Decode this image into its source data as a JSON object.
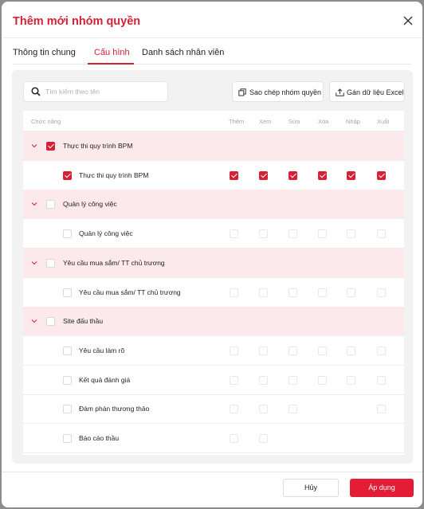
{
  "dialog": {
    "title": "Thêm mới nhóm quyền",
    "close_icon": "close-icon"
  },
  "tabs": [
    {
      "label": "Thông tin chung",
      "active": false
    },
    {
      "label": "Cấu hình",
      "active": true
    },
    {
      "label": "Danh sách nhân viên",
      "active": false
    }
  ],
  "toolbar": {
    "search_placeholder": "Tìm kiếm theo tên",
    "copy_label": "Sao chép nhóm quyền",
    "excel_label": "Gán dữ liệu Excel"
  },
  "table": {
    "headers": [
      "Chức năng",
      "Thêm",
      "Xem",
      "Sửa",
      "Xóa",
      "Nhập",
      "Xuất"
    ],
    "rows": [
      {
        "type": "group",
        "label": "Thực thi quy trình BPM",
        "checked": true
      },
      {
        "type": "item",
        "label": "Thực thi quy trình BPM",
        "checked": true,
        "perms": [
          true,
          true,
          true,
          true,
          true,
          true
        ]
      },
      {
        "type": "group",
        "label": "Quản lý công việc",
        "checked": false
      },
      {
        "type": "item",
        "label": "Quản lý công việc",
        "checked": false,
        "perms": [
          false,
          false,
          false,
          false,
          false,
          false
        ]
      },
      {
        "type": "group",
        "label": "Yêu cầu mua sắm/ TT chủ trương",
        "checked": false
      },
      {
        "type": "item",
        "label": "Yêu cầu mua sắm/ TT chủ trương",
        "checked": false,
        "perms": [
          false,
          false,
          false,
          false,
          false,
          false
        ]
      },
      {
        "type": "group",
        "label": "Site đấu thầu",
        "checked": false
      },
      {
        "type": "item",
        "label": "Yêu cầu làm rõ",
        "checked": false,
        "perms": [
          false,
          false,
          false,
          false,
          false,
          false
        ]
      },
      {
        "type": "item",
        "label": "Kết quả đánh giá",
        "checked": false,
        "perms": [
          false,
          false,
          false,
          false,
          false,
          false
        ]
      },
      {
        "type": "item",
        "label": "Đàm phán thương thảo",
        "checked": false,
        "perms": [
          false,
          false,
          false,
          null,
          null,
          false
        ]
      },
      {
        "type": "item",
        "label": "Báo cáo thầu",
        "checked": false,
        "perms": [
          false,
          false,
          null,
          null,
          null,
          null
        ]
      }
    ]
  },
  "footer": {
    "cancel_label": "Hủy",
    "apply_label": "Áp dụng"
  },
  "colors": {
    "accent": "#d71f35",
    "group_row_bg": "#fbe9eb",
    "panel_bg": "#f2f2f2"
  }
}
